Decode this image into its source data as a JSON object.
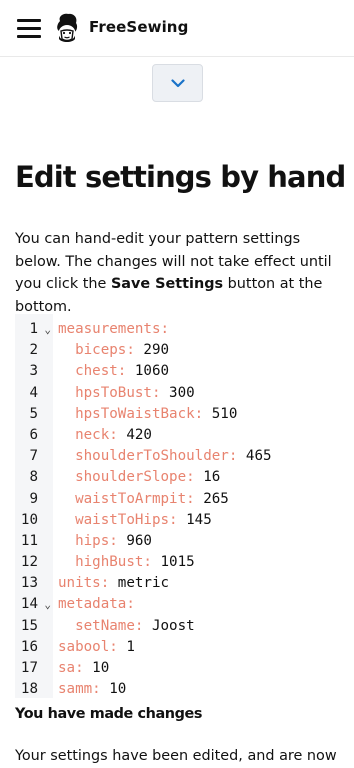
{
  "header": {
    "brand": "FreeSewing",
    "menu_icon": "hamburger-menu-icon",
    "logo_icon": "freesewing-logo-icon"
  },
  "toggle": {
    "icon": "chevron-down-icon"
  },
  "page": {
    "title": "Edit settings by hand",
    "intro_prefix": "You can hand-edit your pattern settings below. The changes will not take effect until you click the ",
    "intro_bold": "Save Settings",
    "intro_suffix": " button at the bottom."
  },
  "editor": {
    "lines": [
      {
        "num": "1",
        "fold": true,
        "indent": "",
        "key": "measurements:",
        "value": ""
      },
      {
        "num": "2",
        "fold": false,
        "indent": "  ",
        "key": "biceps:",
        "value": " 290"
      },
      {
        "num": "3",
        "fold": false,
        "indent": "  ",
        "key": "chest:",
        "value": " 1060"
      },
      {
        "num": "4",
        "fold": false,
        "indent": "  ",
        "key": "hpsToBust:",
        "value": " 300"
      },
      {
        "num": "5",
        "fold": false,
        "indent": "  ",
        "key": "hpsToWaistBack:",
        "value": " 510"
      },
      {
        "num": "6",
        "fold": false,
        "indent": "  ",
        "key": "neck:",
        "value": " 420"
      },
      {
        "num": "7",
        "fold": false,
        "indent": "  ",
        "key": "shoulderToShoulder:",
        "value": " 465"
      },
      {
        "num": "8",
        "fold": false,
        "indent": "  ",
        "key": "shoulderSlope:",
        "value": " 16"
      },
      {
        "num": "9",
        "fold": false,
        "indent": "  ",
        "key": "waistToArmpit:",
        "value": " 265"
      },
      {
        "num": "10",
        "fold": false,
        "indent": "  ",
        "key": "waistToHips:",
        "value": " 145"
      },
      {
        "num": "11",
        "fold": false,
        "indent": "  ",
        "key": "hips:",
        "value": " 960"
      },
      {
        "num": "12",
        "fold": false,
        "indent": "  ",
        "key": "highBust:",
        "value": " 1015"
      },
      {
        "num": "13",
        "fold": false,
        "indent": "",
        "key": "units:",
        "value": " metric"
      },
      {
        "num": "14",
        "fold": true,
        "indent": "",
        "key": "metadata:",
        "value": ""
      },
      {
        "num": "15",
        "fold": false,
        "indent": "  ",
        "key": "setName:",
        "value": " Joost"
      },
      {
        "num": "16",
        "fold": false,
        "indent": "",
        "key": "sabool:",
        "value": " 1"
      },
      {
        "num": "17",
        "fold": false,
        "indent": "",
        "key": "sa:",
        "value": " 10"
      },
      {
        "num": "18",
        "fold": false,
        "indent": "",
        "key": "samm:",
        "value": " 10"
      }
    ]
  },
  "status": {
    "changed_title": "You have made changes",
    "changed_text": "Your settings have been edited, and are now"
  },
  "colors": {
    "yaml_key": "#e8836f",
    "gutter_bg": "#f5f6f8",
    "button_bg": "#eef1f5",
    "chevron": "#1a73c8"
  }
}
